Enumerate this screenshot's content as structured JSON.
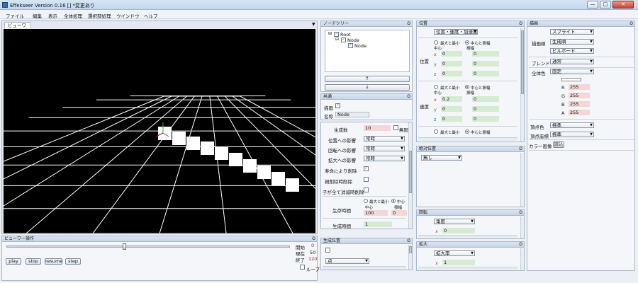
{
  "app": {
    "title": "Effekseer Version 0.16 []  *変更あり"
  },
  "window": {
    "minimize": "—",
    "maximize": "□",
    "close": "✕"
  },
  "menu": [
    "ファイル",
    "編集",
    "表示",
    "全体処理",
    "選択部処理",
    "ウインドウ",
    "ヘルプ"
  ],
  "viewer": {
    "tab": "ビューワー",
    "dropdown": "▼"
  },
  "viewer_ops": {
    "title": "ビューワー操作",
    "pin": "ʘ",
    "start_label": "開始",
    "start_value": "0",
    "current_label": "現在",
    "current_value": "50",
    "end_label": "終了",
    "end_value": "120",
    "loop_label": "ループ",
    "buttons": [
      "play",
      "stop",
      "resume",
      "step"
    ]
  },
  "nodetree": {
    "title": "ノードツリー",
    "pin": "ʘ",
    "nodes": [
      "Root",
      "Node",
      "Node"
    ],
    "up": "↑",
    "down": "↓"
  },
  "common": {
    "title": "共通",
    "pin": "ʘ",
    "draw_label": "描画",
    "draw_check": "✓",
    "name_label": "名称",
    "name_value": "Node"
  },
  "emit": {
    "rows": [
      {
        "label": "生成数",
        "value": "10",
        "extra": "無限"
      },
      {
        "label": "位置への影響",
        "value": "常時"
      },
      {
        "label": "回転への影響",
        "value": "常時"
      },
      {
        "label": "拡大への影響",
        "value": "常時"
      },
      {
        "label": "寿命により削除",
        "check": "✓"
      },
      {
        "label": "親削除時削除"
      },
      {
        "label": "子が全て消滅時削除"
      }
    ],
    "life_label": "生存時間",
    "radio_a": "最大と最小",
    "radio_b": "中心と振幅",
    "col_a": "中心",
    "col_b": "振幅",
    "life_a": "100",
    "life_b": "0",
    "gen_label": "生成時間",
    "gen_value": "1"
  },
  "genpos": {
    "title": "生成位置",
    "pin": "ʘ",
    "mode": "点"
  },
  "position": {
    "title": "位置",
    "pin": "ʘ",
    "mode": "位置・速度・加速度",
    "radio_a": "最大と最小",
    "radio_b": "中心と振幅",
    "col_a": "中心",
    "col_b": "振幅",
    "pos_label": "位置",
    "vel_label": "速度",
    "pos": [
      [
        "x",
        "0",
        "0"
      ],
      [
        "y",
        "0",
        "0"
      ],
      [
        "z",
        "0",
        "0"
      ]
    ],
    "vel": [
      [
        "x",
        "0.2",
        "0"
      ],
      [
        "y",
        "0",
        "0"
      ],
      [
        "z",
        "0",
        "0"
      ]
    ]
  },
  "abspos": {
    "title": "絶対位置",
    "pin": "ʘ",
    "mode": "無し"
  },
  "rotation": {
    "title": "回転",
    "pin": "ʘ",
    "mode": "角度",
    "axis": "x",
    "value": "0"
  },
  "scale": {
    "title": "拡大",
    "pin": "ʘ",
    "mode": "拡大率",
    "axis": "x",
    "value": "1"
  },
  "render": {
    "title": "描画",
    "pin": "ʘ",
    "type": "スプライト",
    "draw_order_label": "描画順",
    "draw_order": "生成順",
    "billboard": "ビルボード",
    "blend_label": "ブレンド",
    "blend": "通常",
    "color_label": "全体色",
    "color_mode": "固定",
    "rgba": [
      [
        "R",
        "255"
      ],
      [
        "G",
        "255"
      ],
      [
        "B",
        "255"
      ],
      [
        "A",
        "255"
      ]
    ],
    "vcolor_label": "頂点色",
    "vcolor": "標準",
    "vpos_label": "頂点座標",
    "vpos": "標準",
    "color_image_label": "カラー画像",
    "load": "読込"
  },
  "colors": {
    "accent": "#2a4f84",
    "viewer_bg": "#000000",
    "grid": "#ffffff"
  }
}
